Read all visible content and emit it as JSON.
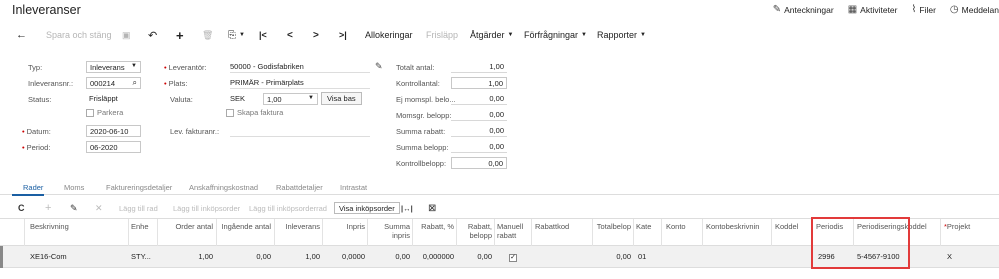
{
  "app": {
    "title": "Inleveranser",
    "top_actions": [
      {
        "label": "Anteckningar",
        "icon": "notes-icon",
        "glyph": "✎"
      },
      {
        "label": "Aktiviteter",
        "icon": "calendar-icon",
        "glyph": "▦"
      },
      {
        "label": "Filer",
        "icon": "paperclip-icon",
        "glyph": "⌇"
      },
      {
        "label": "Meddelan",
        "icon": "alarm-icon",
        "glyph": "◷"
      }
    ]
  },
  "toolbar": {
    "back_glyph": "←",
    "save_close": "Spara och stäng",
    "save_glyph": "▣",
    "undo_glyph": "↶",
    "add_glyph": "+",
    "delete_glyph": "🗑",
    "copy_glyph": "⎘",
    "first_glyph": "|<",
    "prev_glyph": "<",
    "next_glyph": ">",
    "last_glyph": ">|",
    "allokeringar": "Allokeringar",
    "frislapp": "Frisläpp",
    "atgarder": "Åtgärder",
    "forfragningar": "Förfrågningar",
    "rapporter": "Rapporter",
    "caret": "▼"
  },
  "form": {
    "typ_label": "Typ:",
    "typ_value": "Inleverans",
    "inleveransnr_label": "Inleveransnr.:",
    "inleveransnr_value": "000214",
    "status_label": "Status:",
    "status_value": "Frisläppt",
    "parkera_label": "Parkera",
    "datum_label": "Datum:",
    "datum_value": "2020-06-10",
    "period_label": "Period:",
    "period_value": "06-2020",
    "leverantor_label": "Leverantör:",
    "leverantor_value": "50000 - Godisfabriken",
    "plats_label": "Plats:",
    "plats_value": "PRIMÄR - Primärplats",
    "valuta_label": "Valuta:",
    "valuta_code": "SEK",
    "valuta_rate": "1,00",
    "visa_bas": "Visa bas",
    "skapa_faktura_label": "Skapa faktura",
    "lev_fakturanr_label": "Lev. fakturanr.:",
    "totals": [
      {
        "label": "Totalt antal:",
        "value": "1,00"
      },
      {
        "label": "Kontrollantal:",
        "value": "1,00"
      },
      {
        "label": "Ej momspl. belo...",
        "value": "0,00"
      },
      {
        "label": "Momsgr. belopp:",
        "value": "0,00"
      },
      {
        "label": "Summa rabatt:",
        "value": "0,00"
      },
      {
        "label": "Summa belopp:",
        "value": "0,00"
      },
      {
        "label": "Kontrollbelopp:",
        "value": "0,00"
      }
    ]
  },
  "tabs": [
    "Rader",
    "Moms",
    "Faktureringsdetaljer",
    "Anskaffningskostnad",
    "Rabattdetaljer",
    "Intrastat"
  ],
  "grid_toolbar": {
    "refresh_glyph": "C",
    "add_glyph": "+",
    "edit_glyph": "✎",
    "delete_glyph": "✕",
    "lagg_till_rad": "Lägg till rad",
    "lagg_till_inkopsorder": "Lägg till inköpsorder",
    "lagg_till_inkopsorderrad": "Lägg till inköpsorderrad",
    "visa_inkopsorder": "Visa inköpsorder",
    "fit_glyph": "|↔|",
    "excel_glyph": "⊠"
  },
  "grid": {
    "headers": {
      "beskrivning": "Beskrivning",
      "enhet": "Enhe",
      "order_antal": "Order antal",
      "ingaende_antal": "Ingående antal",
      "inleverans": "Inleverans",
      "inpris": "Inpris",
      "summa_inpris": "Summa inpris",
      "rabatt_pct": "Rabatt, %",
      "rabatt_belopp": "Rabatt, belopp",
      "manuell_rabatt": "Manuell rabatt",
      "rabattkod": "Rabattkod",
      "totalbelopp": "Totalbelop",
      "kategori": "Kate",
      "konto": "Konto",
      "kontobeskrivning": "Kontobeskrivnin",
      "koddel": "Koddel",
      "periodis": "Periodis",
      "periodiseringskoddel": "Periodiseringskoddel",
      "projekt": "Projekt"
    },
    "row": {
      "beskrivning": "XE16-Com",
      "enhet": "STY...",
      "order_antal": "1,00",
      "ingaende_antal": "0,00",
      "inleverans": "1,00",
      "inpris": "0,0000",
      "summa_inpris": "0,00",
      "rabatt_pct": "0,000000",
      "rabatt_belopp": "0,00",
      "manuell_rabatt": "✓",
      "totalbelopp": "0,00",
      "kategori": "01",
      "periodis": "2996",
      "periodiseringskoddel": "5-4567-9100",
      "projekt": "X"
    }
  },
  "colors": {
    "accent": "#1a5fa3",
    "highlight_box": "#e23a3a",
    "required": "#cc0000"
  }
}
